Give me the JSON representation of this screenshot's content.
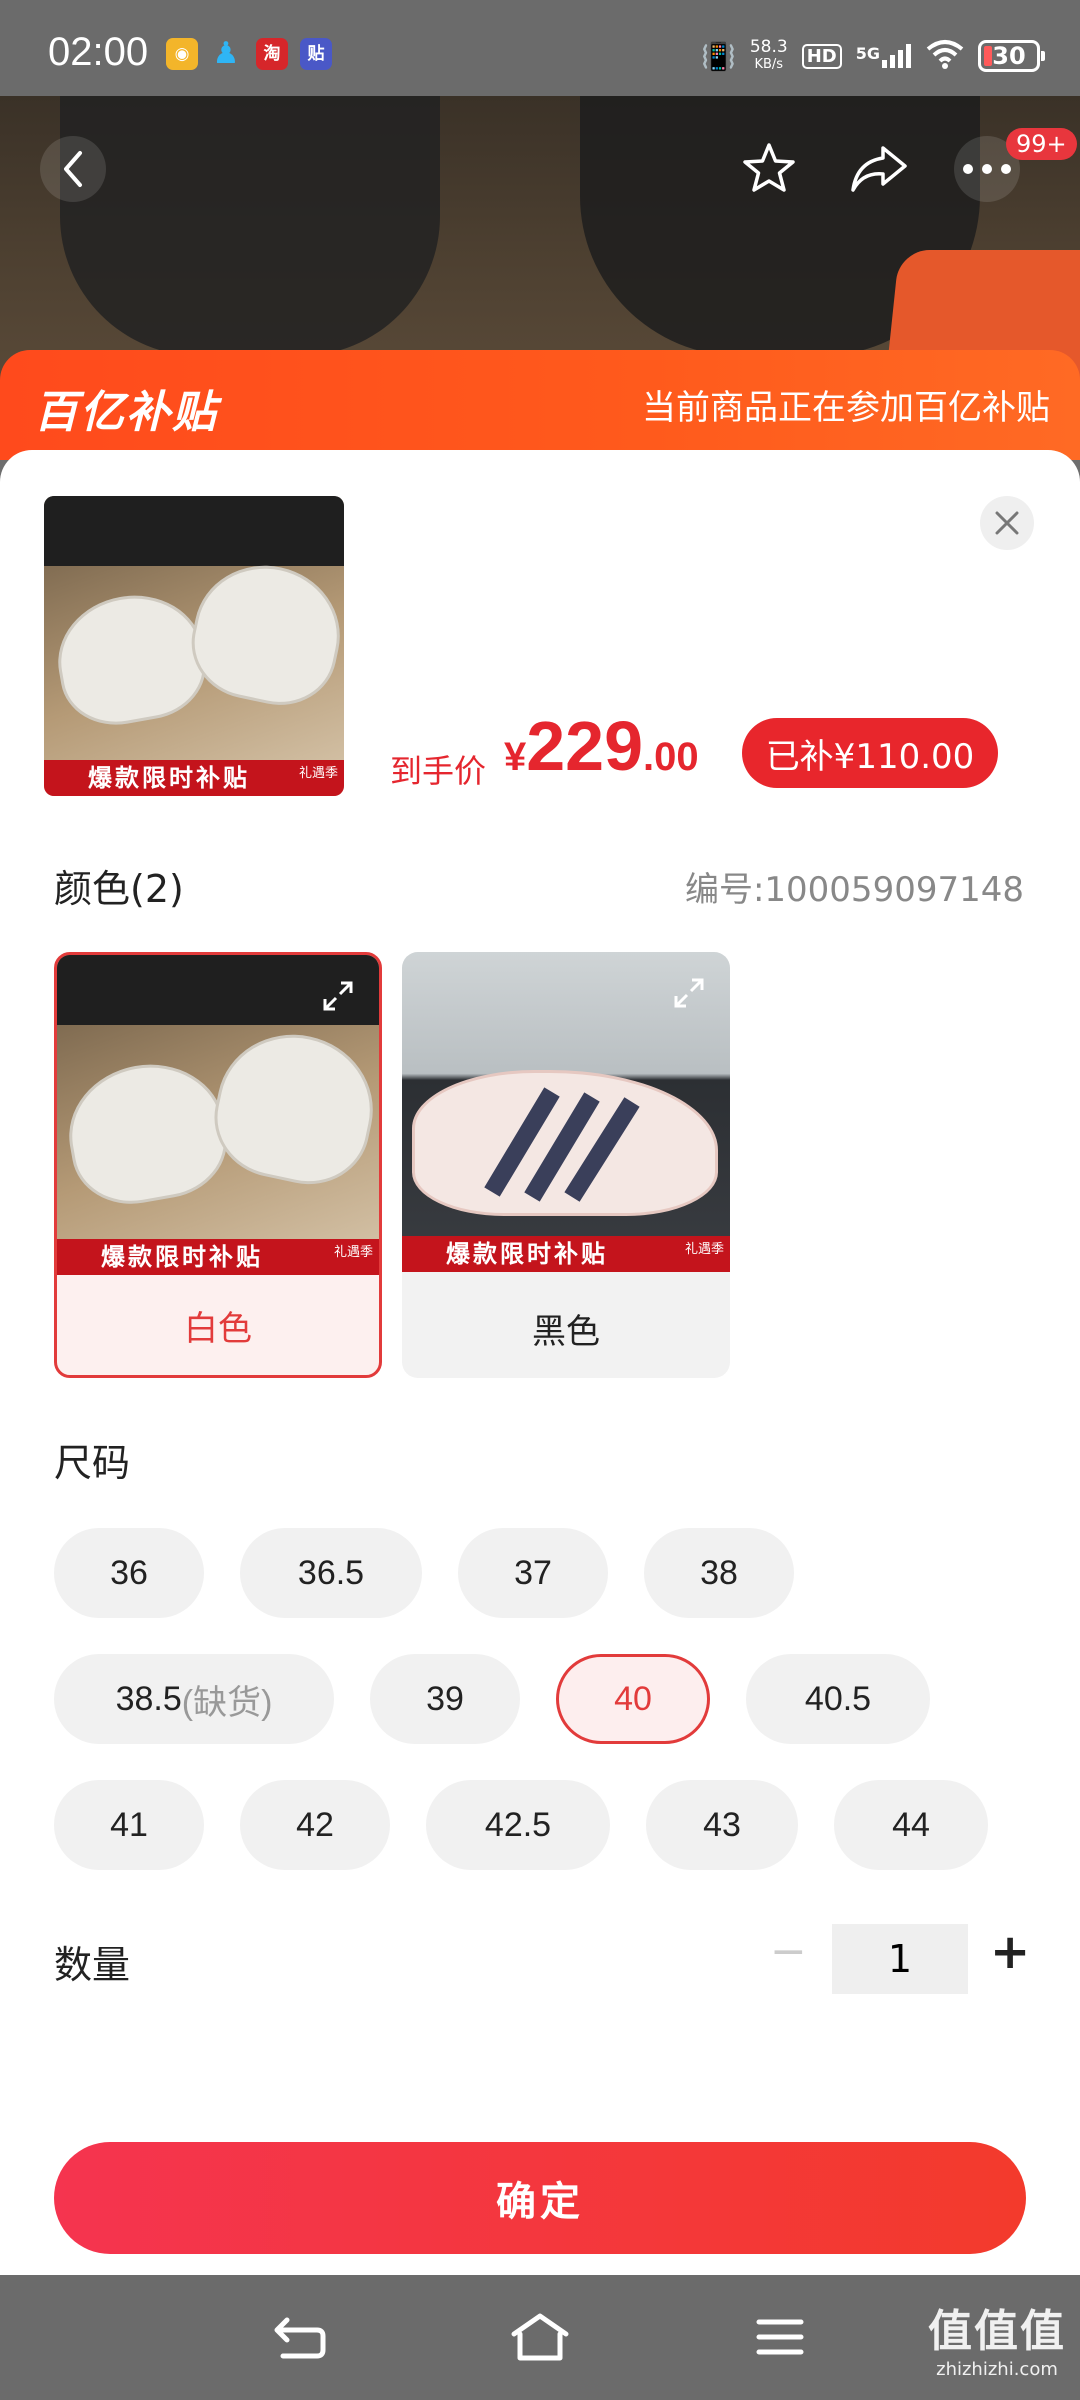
{
  "status_bar": {
    "time": "02:00",
    "net_speed_value": "58.3",
    "net_speed_unit": "KB/s",
    "hd_label": "HD",
    "signal_label": "5G",
    "battery": "30",
    "app_icons": [
      "app-icon-1",
      "qq-icon",
      "taobao-icon",
      "tieba-icon"
    ]
  },
  "header": {
    "back_icon": "back-arrow-icon",
    "favorite_icon": "star-icon",
    "share_icon": "share-icon",
    "more_icon": "more-dots-icon",
    "more_badge": "99+"
  },
  "banner": {
    "logo": "百亿补贴",
    "text": "当前商品正在参加百亿补贴"
  },
  "product": {
    "promo_strip": "爆款限时补贴",
    "promo_tag": "礼遇季",
    "price_label": "到手价",
    "currency": "¥",
    "price_int": "229",
    "price_dec": ".00",
    "subsidy": "已补¥110.00"
  },
  "color_section": {
    "title": "颜色(2)",
    "serial": "编号:100059097148",
    "options": [
      {
        "label": "白色",
        "selected": true
      },
      {
        "label": "黑色",
        "selected": false
      }
    ]
  },
  "size_section": {
    "title": "尺码",
    "sizes": [
      "36",
      "36.5",
      "37",
      "38",
      "38.5",
      "39",
      "40",
      "40.5",
      "41",
      "42",
      "42.5",
      "43",
      "44"
    ],
    "out_of_stock_note": "(缺货)",
    "selected": "40"
  },
  "quantity": {
    "label": "数量",
    "minus": "−",
    "value": "1",
    "plus": "+"
  },
  "confirm_button": "确定",
  "watermark": {
    "big": "值值值",
    "small": "zhizhizhi.com"
  },
  "colors": {
    "accent": "#e8262c",
    "banner": "#ff4a1c"
  }
}
